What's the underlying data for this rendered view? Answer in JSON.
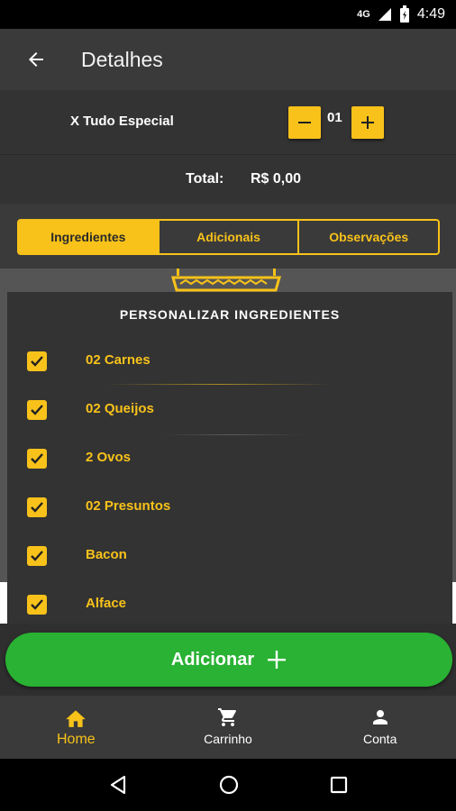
{
  "status_bar": {
    "network": "4G",
    "time": "4:49"
  },
  "app_bar": {
    "title": "Detalhes"
  },
  "product": {
    "name": "X Tudo Especial",
    "quantity": "01"
  },
  "total": {
    "label": "Total:",
    "value": "R$ 0,00"
  },
  "tabs": [
    {
      "label": "Ingredientes",
      "active": true
    },
    {
      "label": "Adicionais",
      "active": false
    },
    {
      "label": "Observações",
      "active": false
    }
  ],
  "ingredients": {
    "title": "PERSONALIZAR INGREDIENTES",
    "items": [
      {
        "label": "02 Carnes",
        "checked": true
      },
      {
        "label": "02 Queijos",
        "checked": true
      },
      {
        "label": "2 Ovos",
        "checked": true
      },
      {
        "label": "02 Presuntos",
        "checked": true
      },
      {
        "label": "Bacon",
        "checked": true
      },
      {
        "label": "Alface",
        "checked": true
      }
    ]
  },
  "add_button": {
    "label": "Adicionar"
  },
  "bottom_nav": [
    {
      "label": "Home",
      "icon": "home-icon",
      "active": true
    },
    {
      "label": "Carrinho",
      "icon": "cart-icon",
      "active": false
    },
    {
      "label": "Conta",
      "icon": "person-icon",
      "active": false
    }
  ],
  "colors": {
    "accent": "#f8c21a",
    "success": "#29b233",
    "background": "#2f2f2f",
    "surface": "#333333"
  }
}
